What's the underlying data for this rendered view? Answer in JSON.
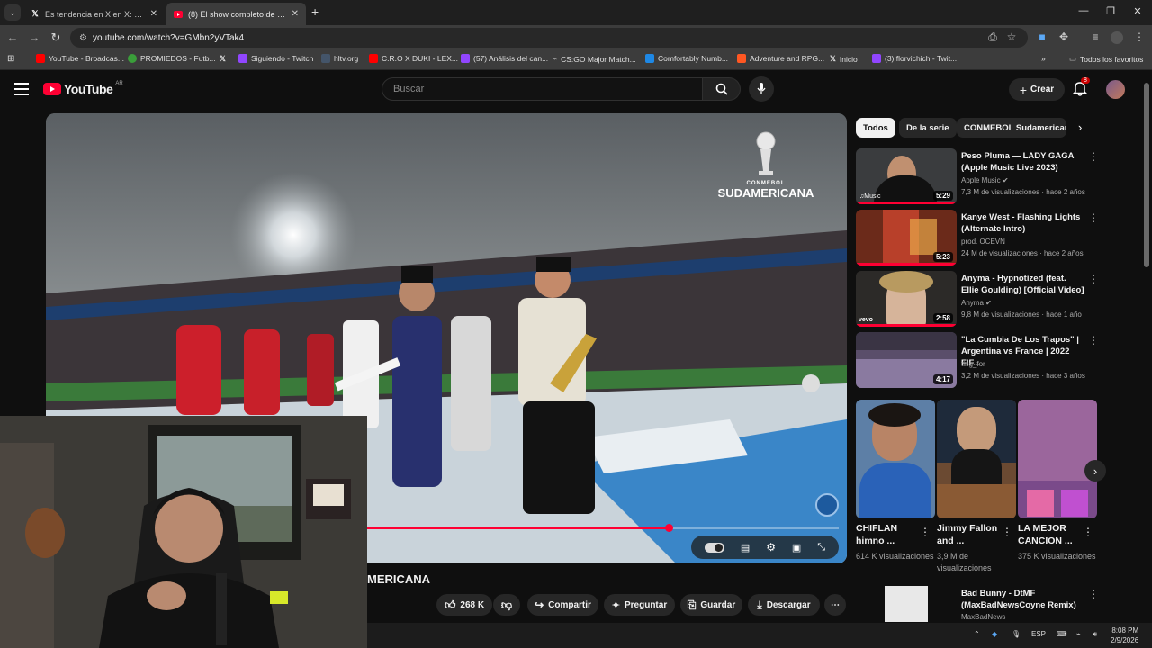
{
  "browser": {
    "tabs": [
      {
        "title": "Es tendencia en X en X: \"\"Harry",
        "icon": "x-logo-icon",
        "active": false
      },
      {
        "title": "(8) El show completo de LOS PALMERAS",
        "icon": "youtube-icon",
        "active": true
      }
    ],
    "url": "youtube.com/watch?v=GMbn2yVTak4",
    "bookmarks": [
      {
        "label": "YouTube - Broadcas...",
        "color": "#ff0000"
      },
      {
        "label": "PROMIEDOS - Futb...",
        "color": "#3a9e3a"
      },
      {
        "label": "",
        "color": "#000000"
      },
      {
        "label": "Siguiendo - Twitch",
        "color": "#9146ff"
      },
      {
        "label": "hltv.org",
        "color": "#44556a"
      },
      {
        "label": "C.R.O X DUKI - LEX...",
        "color": "#ff0000"
      },
      {
        "label": "(57) Análisis del can...",
        "color": "#9146ff"
      },
      {
        "label": "CS:GO Major Match...",
        "color": "#888888"
      },
      {
        "label": "Comfortably Numb...",
        "color": "#1e88e5"
      },
      {
        "label": "Adventure and RPG...",
        "color": "#ff5722"
      },
      {
        "label": "Inicio",
        "color": "#000000"
      },
      {
        "label": "(3) florvichich - Twit...",
        "color": "#9146ff"
      }
    ],
    "all_bookmarks": "Todos los favoritos"
  },
  "youtube": {
    "logo": "YouTube",
    "region": "AR",
    "search_placeholder": "Buscar",
    "create_label": "Crear",
    "notifications": "8"
  },
  "video": {
    "overlay_logo_line1": "CONMEBOL",
    "overlay_logo_line2": "SUDAMERICANA",
    "progress": 0.64,
    "title_visible": "MERICANA",
    "likes": "268 K",
    "share": "Compartir",
    "ask": "Preguntar",
    "save": "Guardar",
    "download": "Descargar"
  },
  "chips": [
    "Todos",
    "De la serie",
    "CONMEBOL Sudamericana"
  ],
  "recommendations": [
    {
      "title": "Peso Pluma — LADY GAGA (Apple Music Live 2023)",
      "channel": "Apple Music",
      "meta": "7,3 M de visualizaciones · hace 2 años",
      "duration": "5:29",
      "verified": true,
      "thumb": "#3a3c3e"
    },
    {
      "title": "Kanye West - Flashing Lights (Alternate Intro)",
      "channel": "prod. OCEVN",
      "meta": "24 M de visualizaciones · hace 2 años",
      "duration": "5:23",
      "verified": false,
      "thumb": "#6b2a1a"
    },
    {
      "title": "Anyma - Hypnotized (feat. Ellie Goulding) [Official Video]",
      "channel": "Anyma",
      "meta": "9,8 M de visualizaciones · hace 1 año",
      "duration": "2:58",
      "verified": true,
      "thumb": "#2c2a28"
    },
    {
      "title": "\"La Cumbia De Los Trapos\" | Argentina vs France | 2022 FIF...",
      "channel": "ting_for",
      "meta": "3,2 M de visualizaciones · hace 3 años",
      "duration": "4:17",
      "verified": false,
      "thumb": "#5a4e6a"
    }
  ],
  "shorts": [
    {
      "title": "CHIFLAN himno ...",
      "views": "614 K visualizaciones",
      "thumb": "#5d7fa6"
    },
    {
      "title": "Jimmy Fallon and ...",
      "views": "3,9 M de visualizaciones",
      "thumb": "#6b4a32"
    },
    {
      "title": "LA MEJOR CANCION ...",
      "views": "375 K visualizaciones",
      "thumb": "#7a4a8a"
    }
  ],
  "bottom_rec": {
    "title": "Bad Bunny - DtMF (MaxBadNewsCoyne Remix)",
    "channel": "MaxBadNews"
  },
  "taskbar": {
    "lang": "ESP",
    "time": "8:08 PM",
    "date": "2/9/2026"
  }
}
